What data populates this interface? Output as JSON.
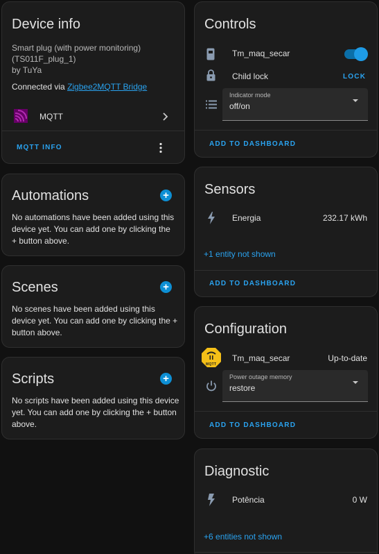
{
  "device_info": {
    "title": "Device info",
    "model_line1": "Smart plug (with power monitoring)",
    "model_line2": "(TS011F_plug_1)",
    "manufacturer": "by TuYa",
    "connected_prefix": "Connected via ",
    "connected_link": "Zigbee2MQTT Bridge",
    "integration_label": "MQTT",
    "mqtt_info_button": "MQTT INFO"
  },
  "automations": {
    "title": "Automations",
    "description": "No automations have been added using this device yet. You can add one by clicking the + button above."
  },
  "scenes": {
    "title": "Scenes",
    "description": "No scenes have been added using this device yet. You can add one by clicking the + button above."
  },
  "scripts": {
    "title": "Scripts",
    "description": "No scripts have been added using this device yet. You can add one by clicking the + button above."
  },
  "controls": {
    "title": "Controls",
    "switch_label": "Tm_maq_secar",
    "switch_on": true,
    "child_lock_label": "Child lock",
    "child_lock_action": "LOCK",
    "indicator_mode_label": "Indicator mode",
    "indicator_mode_value": "off/on",
    "add_to_dashboard": "ADD TO DASHBOARD"
  },
  "sensors": {
    "title": "Sensors",
    "energy_label": "Energia",
    "energy_value": "232.17 kWh",
    "hidden_entities": "+1 entity not shown",
    "add_to_dashboard": "ADD TO DASHBOARD"
  },
  "configuration": {
    "title": "Configuration",
    "firmware_label": "Tm_maq_secar",
    "firmware_status": "Up-to-date",
    "firmware_badge": "MQTT",
    "power_outage_label": "Power outage memory",
    "power_outage_value": "restore",
    "add_to_dashboard": "ADD TO DASHBOARD"
  },
  "diagnostic": {
    "title": "Diagnostic",
    "power_label": "Potência",
    "power_value": "0 W",
    "hidden_entities": "+6 entities not shown"
  },
  "colors": {
    "accent": "#2aa3f0",
    "toggle_on": "#0d8fd4",
    "card_bg": "#1c1c1c",
    "page_bg": "#111111",
    "icon_gray": "#8a9bb0",
    "mqtt_purple": "#660066"
  }
}
